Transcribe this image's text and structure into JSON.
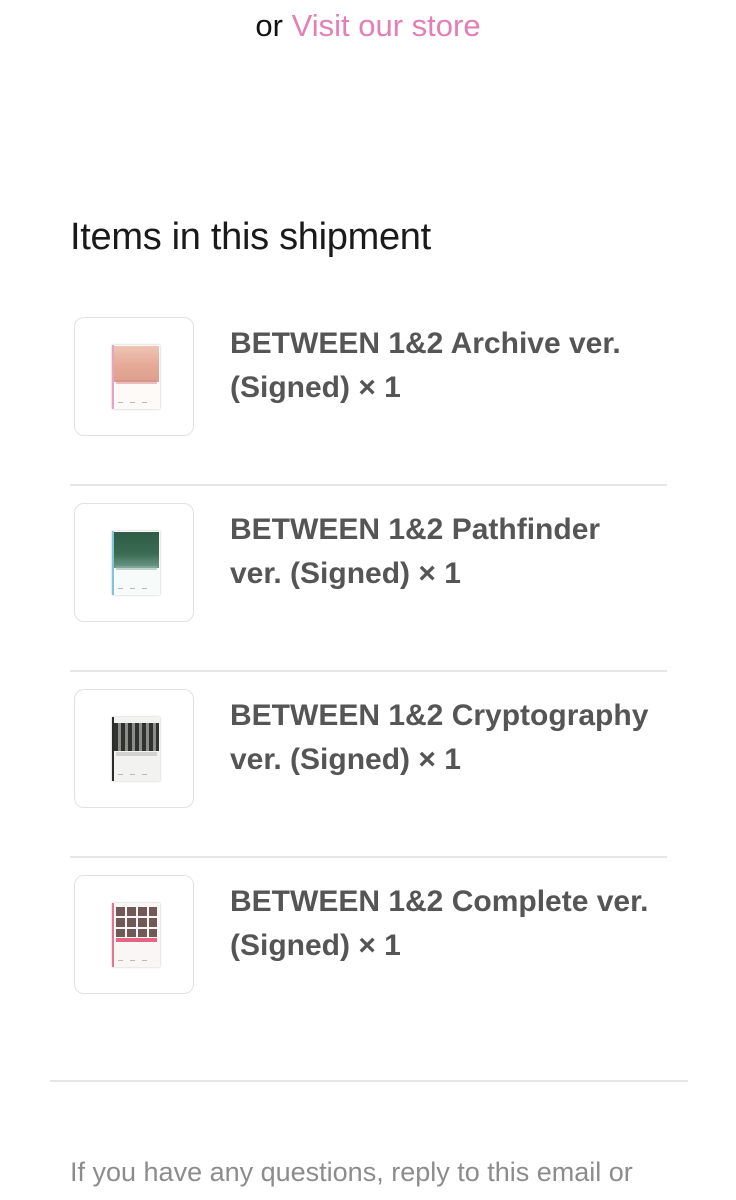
{
  "store_line": {
    "prefix": "or",
    "link_label": "Visit our store"
  },
  "shipment": {
    "title": "Items in this shipment",
    "items": [
      {
        "name": "BETWEEN 1&2 Archive ver.",
        "variant_qty": "(Signed) × 1",
        "cover_colors": {
          "photo": "#e9b7a7",
          "spine": "#e8a4be",
          "title": "#d98d8d"
        }
      },
      {
        "name": "BETWEEN 1&2 Pathfinder",
        "variant_qty": "ver. (Signed) × 1",
        "cover_colors": {
          "photo": "#2f5a45",
          "spine": "#7fc6dd",
          "title": "#8fb5ac"
        }
      },
      {
        "name": "BETWEEN 1&2 Cryptography",
        "variant_qty": "ver. (Signed) × 1",
        "cover_colors": {
          "photo": "#3a3d3a",
          "spine": "#2a2a2a",
          "title": "#b8bab7"
        }
      },
      {
        "name": "BETWEEN 1&2 Complete ver.",
        "variant_qty": "(Signed) × 1",
        "cover_colors": {
          "photo": "#7c6460",
          "spine": "#e27692",
          "title": "#e04a6c"
        }
      }
    ]
  },
  "footer": {
    "text": "If you have any questions, reply to this email or"
  }
}
